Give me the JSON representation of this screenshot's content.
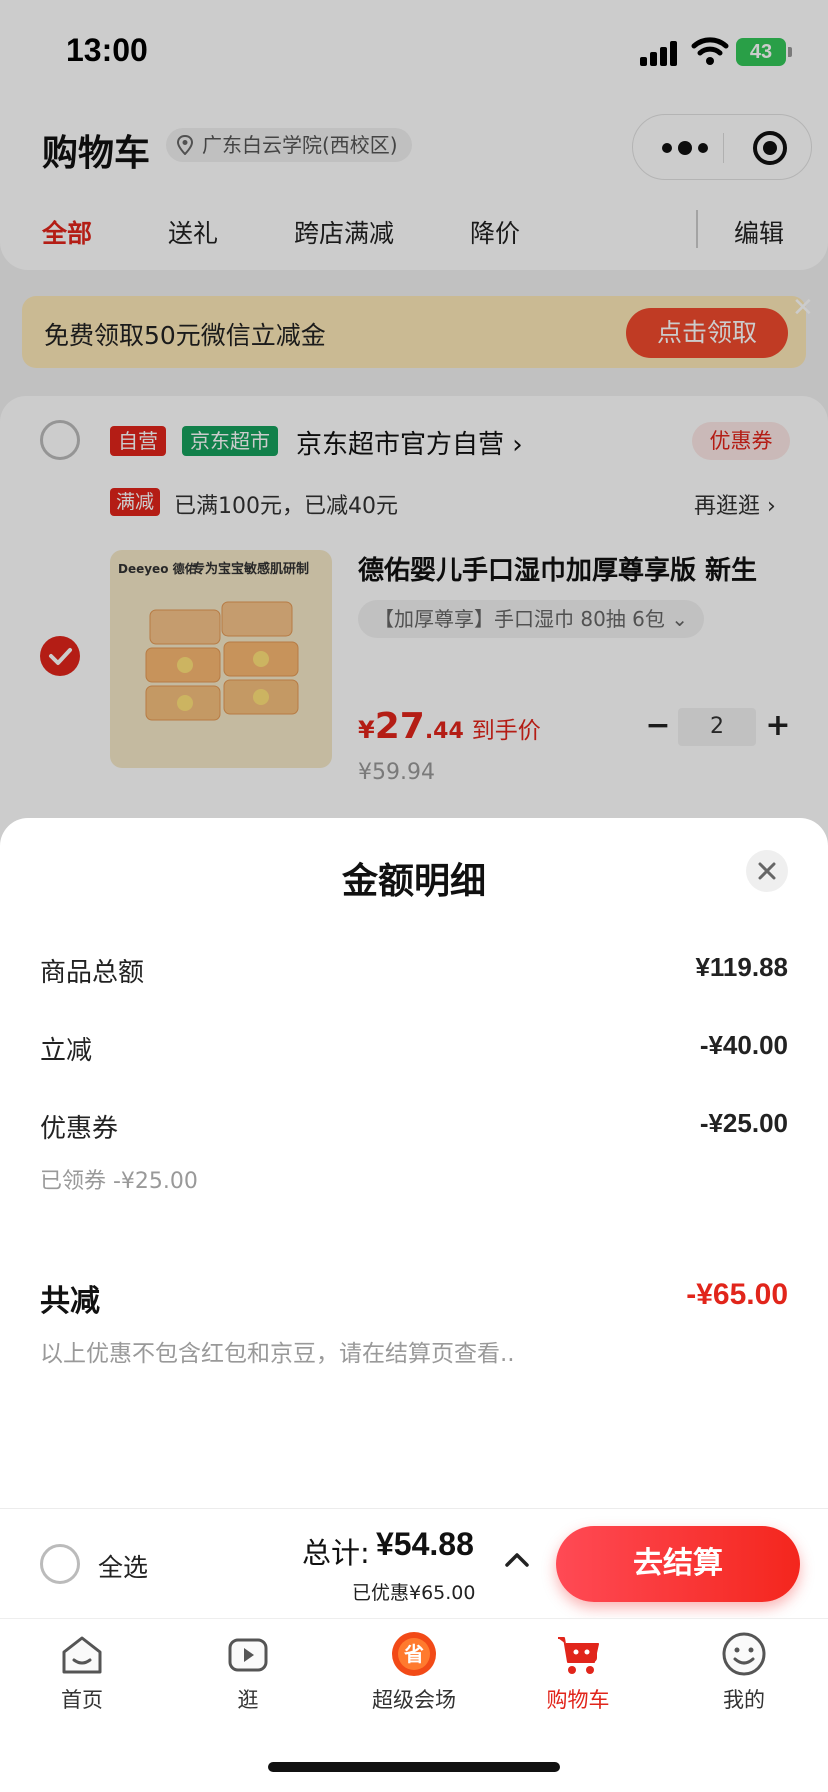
{
  "status": {
    "time": "13:00",
    "battery": "43"
  },
  "header": {
    "title": "购物车",
    "location": "广东白云学院(西校区)"
  },
  "tabs": [
    "全部",
    "送礼",
    "跨店满减",
    "降价",
    "编辑"
  ],
  "banner": {
    "text": "免费领取50元微信立减金",
    "button": "点击领取",
    "close": "✕"
  },
  "store": {
    "badge_self": "自营",
    "badge_jd": "京东超市",
    "name": "京东超市官方自营 ›",
    "coupon": "优惠券",
    "promo_tag": "满减",
    "promo_text": "已满100元，已减40元",
    "promo_more": "再逛逛 ›"
  },
  "product": {
    "brand": "Deeyeo 德佑",
    "slogan": "专为宝宝敏感肌研制",
    "title": "德佑婴儿手口湿巾加厚尊享版 新生",
    "sku": "【加厚尊享】手口湿巾 80抽 6包 ⌄",
    "price_symbol": "¥",
    "price_int": "27",
    "price_dec": ".44",
    "price_label": "到手价",
    "orig_price": "¥59.94",
    "qty": "2",
    "minus": "−",
    "plus": "+"
  },
  "sheet": {
    "title": "金额明细",
    "rows": [
      {
        "label": "商品总额",
        "value": "¥119.88"
      },
      {
        "label": "立减",
        "value": "-¥40.00"
      },
      {
        "label": "优惠券",
        "value": "-¥25.00"
      }
    ],
    "coupon_note": "已领券 -¥25.00",
    "total_label": "共减",
    "total_value": "-¥65.00",
    "total_note": "以上优惠不包含红包和京豆，请在结算页查看.."
  },
  "checkout": {
    "select_all": "全选",
    "sum_label": "总计:",
    "sum_value": "¥54.88",
    "saved": "已优惠¥65.00",
    "button": "去结算"
  },
  "tabbar": [
    {
      "label": "首页",
      "icon": "home-icon"
    },
    {
      "label": "逛",
      "icon": "video-icon"
    },
    {
      "label": "超级会场",
      "icon": "super-venue-icon"
    },
    {
      "label": "购物车",
      "icon": "cart-icon"
    },
    {
      "label": "我的",
      "icon": "profile-icon"
    }
  ],
  "colors": {
    "accent": "#e1251b",
    "jd_green": "#16a05d",
    "banner_bg": "#fde9b8"
  }
}
